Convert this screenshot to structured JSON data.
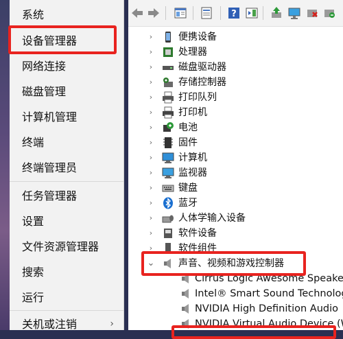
{
  "menu": {
    "items": [
      {
        "label": "系统",
        "key": "system"
      },
      {
        "label": "设备管理器",
        "key": "device-manager"
      },
      {
        "label": "网络连接",
        "key": "network-connections"
      },
      {
        "label": "磁盘管理",
        "key": "disk-management"
      },
      {
        "label": "计算机管理",
        "key": "computer-management"
      },
      {
        "label": "终端",
        "key": "terminal"
      },
      {
        "label": "终端管理员",
        "key": "terminal-admin"
      },
      {
        "label": "任务管理器",
        "key": "task-manager"
      },
      {
        "label": "设置",
        "key": "settings"
      },
      {
        "label": "文件资源管理器",
        "key": "file-explorer"
      },
      {
        "label": "搜索",
        "key": "search"
      },
      {
        "label": "运行",
        "key": "run"
      },
      {
        "label": "关机或注销",
        "key": "shutdown-signout"
      }
    ],
    "chevron": "›"
  },
  "device_tree": {
    "categories": [
      {
        "label": "便携设备",
        "icon": "portable-device-icon"
      },
      {
        "label": "处理器",
        "icon": "processor-icon"
      },
      {
        "label": "磁盘驱动器",
        "icon": "disk-drive-icon"
      },
      {
        "label": "存储控制器",
        "icon": "storage-controller-icon"
      },
      {
        "label": "打印队列",
        "icon": "print-queue-icon"
      },
      {
        "label": "打印机",
        "icon": "printer-icon"
      },
      {
        "label": "电池",
        "icon": "battery-icon"
      },
      {
        "label": "固件",
        "icon": "firmware-icon"
      },
      {
        "label": "计算机",
        "icon": "computer-icon"
      },
      {
        "label": "监视器",
        "icon": "monitor-icon"
      },
      {
        "label": "键盘",
        "icon": "keyboard-icon"
      },
      {
        "label": "蓝牙",
        "icon": "bluetooth-icon"
      },
      {
        "label": "人体学输入设备",
        "icon": "hid-icon"
      },
      {
        "label": "软件设备",
        "icon": "software-device-icon"
      },
      {
        "label": "软件组件",
        "icon": "software-component-icon"
      },
      {
        "label": "声音、视频和游戏控制器",
        "icon": "speaker-icon"
      }
    ],
    "audio_devices": [
      "Cirrus Logic Awesome Speaker A",
      "Intel® Smart Sound Technology",
      "NVIDIA High Definition Audio",
      "NVIDIA Virtual Audio Device (Wa"
    ],
    "collapsed_glyph": "›",
    "expanded_glyph": "⌄"
  },
  "colors": {
    "highlight": "#e8231f",
    "menu_bg": "#f2f2f2"
  }
}
